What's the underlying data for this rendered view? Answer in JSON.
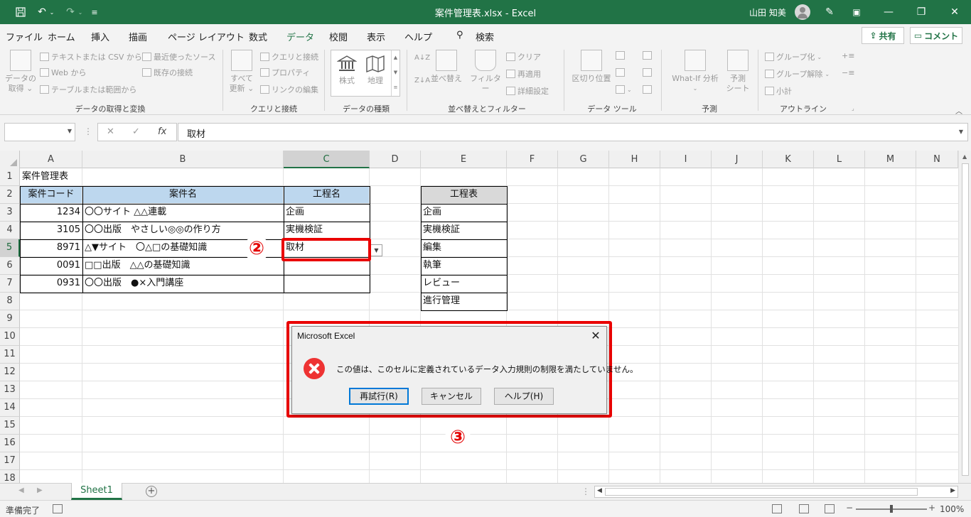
{
  "titlebar": {
    "title": "案件管理表.xlsx  -  Excel",
    "user": "山田 知美",
    "minimize_glyph": "—",
    "restore_glyph": "❐",
    "close_glyph": "✕"
  },
  "tabs": [
    "ファイル",
    "ホーム",
    "挿入",
    "描画",
    "ページ レイアウト",
    "数式",
    "データ",
    "校閲",
    "表示",
    "ヘルプ",
    "検索"
  ],
  "active_tab": "データ",
  "share_label": "共有",
  "comment_label": "コメント",
  "ribbon": {
    "get_data": {
      "label_line1": "データの",
      "label_line2": "取得 ⌄"
    },
    "text_csv": "テキストまたは CSV から",
    "web": "Web から",
    "table_range": "テーブルまたは範囲から",
    "recent_sources": "最近使ったソース",
    "existing_conn": "既存の接続",
    "group1": "データの取得と変換",
    "refresh_all": {
      "line1": "すべて",
      "line2": "更新 ⌄"
    },
    "queries_conn": "クエリと接続",
    "properties": "プロパティ",
    "edit_links": "リンクの編集",
    "group2": "クエリと接続",
    "stocks": "株式",
    "geography": "地理",
    "group3": "データの種類",
    "sort": "並べ替え",
    "filter": "フィルター",
    "clear": "クリア",
    "reapply": "再適用",
    "advanced": "詳細設定",
    "group4": "並べ替えとフィルター",
    "text_to_columns": "区切り位置",
    "group5": "データ ツール",
    "whatif": "What-If 分析",
    "forecast_sheet": {
      "line1": "予測",
      "line2": "シート"
    },
    "group6": "予測",
    "group_btn": "グループ化",
    "ungroup_btn": "グループ解除",
    "subtotal": "小計",
    "group7": "アウトライン"
  },
  "formula_bar": {
    "name_box": "",
    "cancel_glyph": "✕",
    "enter_glyph": "✓",
    "fx_glyph": "fx",
    "value": "取材"
  },
  "columns": [
    "A",
    "B",
    "C",
    "D",
    "E",
    "F",
    "G",
    "H",
    "I",
    "J",
    "K",
    "L",
    "M",
    "N"
  ],
  "rows": [
    "1",
    "2",
    "3",
    "4",
    "5",
    "6",
    "7",
    "8",
    "9",
    "10",
    "11",
    "12",
    "13",
    "14",
    "15",
    "16",
    "17",
    "18"
  ],
  "sheet": {
    "title": "案件管理表",
    "headers": {
      "code": "案件コード",
      "name": "案件名",
      "process": "工程名"
    },
    "data": [
      {
        "code": "1234",
        "name": "〇〇サイト △△連載",
        "process": "企画"
      },
      {
        "code": "3105",
        "name": "〇〇出版　やさしい◎◎の作り方",
        "process": "実機検証"
      },
      {
        "code": "8971",
        "name": "△▼サイト　〇△□の基礎知識",
        "process": "取材"
      },
      {
        "code": "0091",
        "name": "□□出版　△△の基礎知識",
        "process": ""
      },
      {
        "code": "0931",
        "name": "〇〇出版　●×入門講座",
        "process": ""
      }
    ],
    "process_table": {
      "header": "工程表",
      "items": [
        "企画",
        "実機検証",
        "編集",
        "執筆",
        "レビュー",
        "進行管理"
      ]
    }
  },
  "annotations": {
    "step2": "②",
    "step3": "③"
  },
  "dialog": {
    "title": "Microsoft Excel",
    "close_glyph": "✕",
    "message": "この値は、このセルに定義されているデータ入力規則の制限を満たしていません。",
    "retry": "再試行(R)",
    "cancel": "キャンセル",
    "help": "ヘルプ(H)"
  },
  "sheet_tabs": [
    "Sheet1"
  ],
  "status": {
    "text": "準備完了",
    "zoom": "100%"
  },
  "colors": {
    "excel_green": "#217346",
    "header_blue": "#bdd7ee",
    "annotation_red": "#ea0000"
  }
}
